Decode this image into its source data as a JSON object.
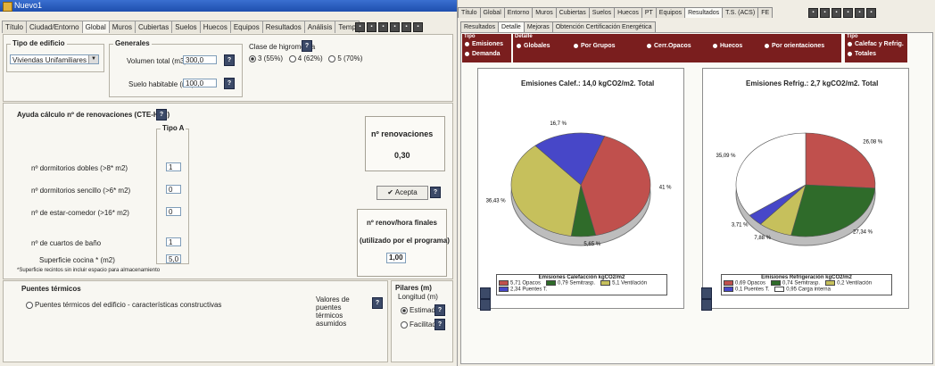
{
  "left": {
    "title": "Nuevo1",
    "tabs": [
      "Título",
      "Ciudad/Entorno",
      "Global",
      "Muros",
      "Cubiertas",
      "Suelos",
      "Huecos",
      "Equipos",
      "Resultados",
      "Análisis",
      "Temp"
    ],
    "active_tab": "Global",
    "tipo_edificio": {
      "label": "Tipo de edificio",
      "value": "Viviendas Unifamiliares"
    },
    "generales": {
      "label": "Generales",
      "volumen_label": "Volumen total (m3)",
      "volumen_value": "300,0",
      "suelo_label": "Suelo habitable (m2)",
      "suelo_value": "100,0"
    },
    "higrometria": {
      "label": "Clase de higrometría",
      "options": [
        "3 (55%)",
        "4 (62%)",
        "5 (70%)"
      ],
      "selected": "3 (55%)"
    },
    "ayuda": {
      "title": "Ayuda cálculo nº de renovaciones (CTE-HS3)",
      "tipo": "Tipo A",
      "rows": [
        {
          "label": "nº dormitorios dobles (>8* m2)",
          "value": "1"
        },
        {
          "label": "nº dormitorios sencillo (>6* m2)",
          "value": "0"
        },
        {
          "label": "nº de estar-comedor (>16* m2)",
          "value": "0"
        },
        {
          "label": "nº de cuartos de baño",
          "value": "1"
        },
        {
          "label": "Superficie cocina * (m2)",
          "value": "5,0"
        }
      ],
      "note": "*Superficie recintos sin incluir espacio para almacenamiento"
    },
    "renovaciones": {
      "label": "nº renovaciones",
      "value": "0,30"
    },
    "aceptar": "Acepta",
    "renov_finales": {
      "line1": "nº renov/hora finales",
      "line2": "(utilizado por el programa)",
      "value": "1,00"
    },
    "puentes": {
      "title": "Puentes térmicos",
      "option": "Puentes térmicos del edificio - características constructivas",
      "valores": "Valores de puentes térmicos asumidos"
    },
    "pilares": {
      "title": "Pilares (m)",
      "longitud": "Longitud (m)",
      "options": [
        "Estimado",
        "Facilitado"
      ],
      "selected": "Estimado"
    }
  },
  "right": {
    "top_tabs": [
      "Título",
      "Global",
      "Entorno",
      "Muros",
      "Cubiertas",
      "Suelos",
      "Huecos",
      "PT",
      "Equipos",
      "Resultados",
      "T.S. (ACS)",
      "FE"
    ],
    "active_top_tab": "Resultados",
    "sub_tabs": [
      "Resultados",
      "Detalle",
      "Mejoras",
      "Obtención Certificación Energética"
    ],
    "active_sub_tab": "Detalle",
    "tipo": {
      "label": "Tipo",
      "options": [
        "Emisiones",
        "Demanda"
      ]
    },
    "detalle": {
      "label": "Detalle",
      "options": [
        "Globales",
        "Por Grupos",
        "Cerr.Opacos",
        "Huecos",
        "Por orientaciones"
      ]
    },
    "tipo2": {
      "label": "Tipo",
      "options": [
        "Calefac y Refrig.",
        "Totales"
      ]
    },
    "chart1": {
      "title": "Emisiones Calef.: 14,0 kgCO2/m2. Total",
      "legend_title": "Emisiones Calefacción kgCO2/m2"
    },
    "chart2": {
      "title": "Emisiones Refrig.: 2,7 kgCO2/m2. Total",
      "legend_title": "Emisiones Refrigeración kgCO2/m2"
    }
  },
  "chart_data": [
    {
      "type": "pie",
      "title": "Emisiones Calef.: 14,0 kgCO2/m2. Total",
      "series": [
        {
          "name": "5,71 Opacos",
          "value": 41,
          "label": "41 %",
          "color": "#c0504d"
        },
        {
          "name": "0,79 Semitrasp.",
          "value": 5.65,
          "label": "5,65 %",
          "color": "#2f6b2a"
        },
        {
          "name": "5,1 Ventilación",
          "value": 36.43,
          "label": "36,43 %",
          "color": "#c6c05c"
        },
        {
          "name": "2,34 Puentes T.",
          "value": 16.92,
          "label": "16,7 %",
          "color": "#4747c8"
        }
      ]
    },
    {
      "type": "pie",
      "title": "Emisiones Refrig.: 2,7 kgCO2/m2. Total",
      "series": [
        {
          "name": "0,69 Opacos",
          "value": 26.08,
          "label": "26,08 %",
          "color": "#c0504d"
        },
        {
          "name": "0,74 Semitrasp.",
          "value": 27.34,
          "label": "27,34 %",
          "color": "#2f6b2a"
        },
        {
          "name": "0,2 Ventilación",
          "value": 7.88,
          "label": "7,88 %",
          "color": "#c6c05c"
        },
        {
          "name": "0,1 Puentes T.",
          "value": 3.71,
          "label": "3,71 %",
          "color": "#4747c8"
        },
        {
          "name": "0,95 Carga interna",
          "value": 35.09,
          "label": "35,09 %",
          "color": "#ffffff"
        }
      ]
    }
  ]
}
